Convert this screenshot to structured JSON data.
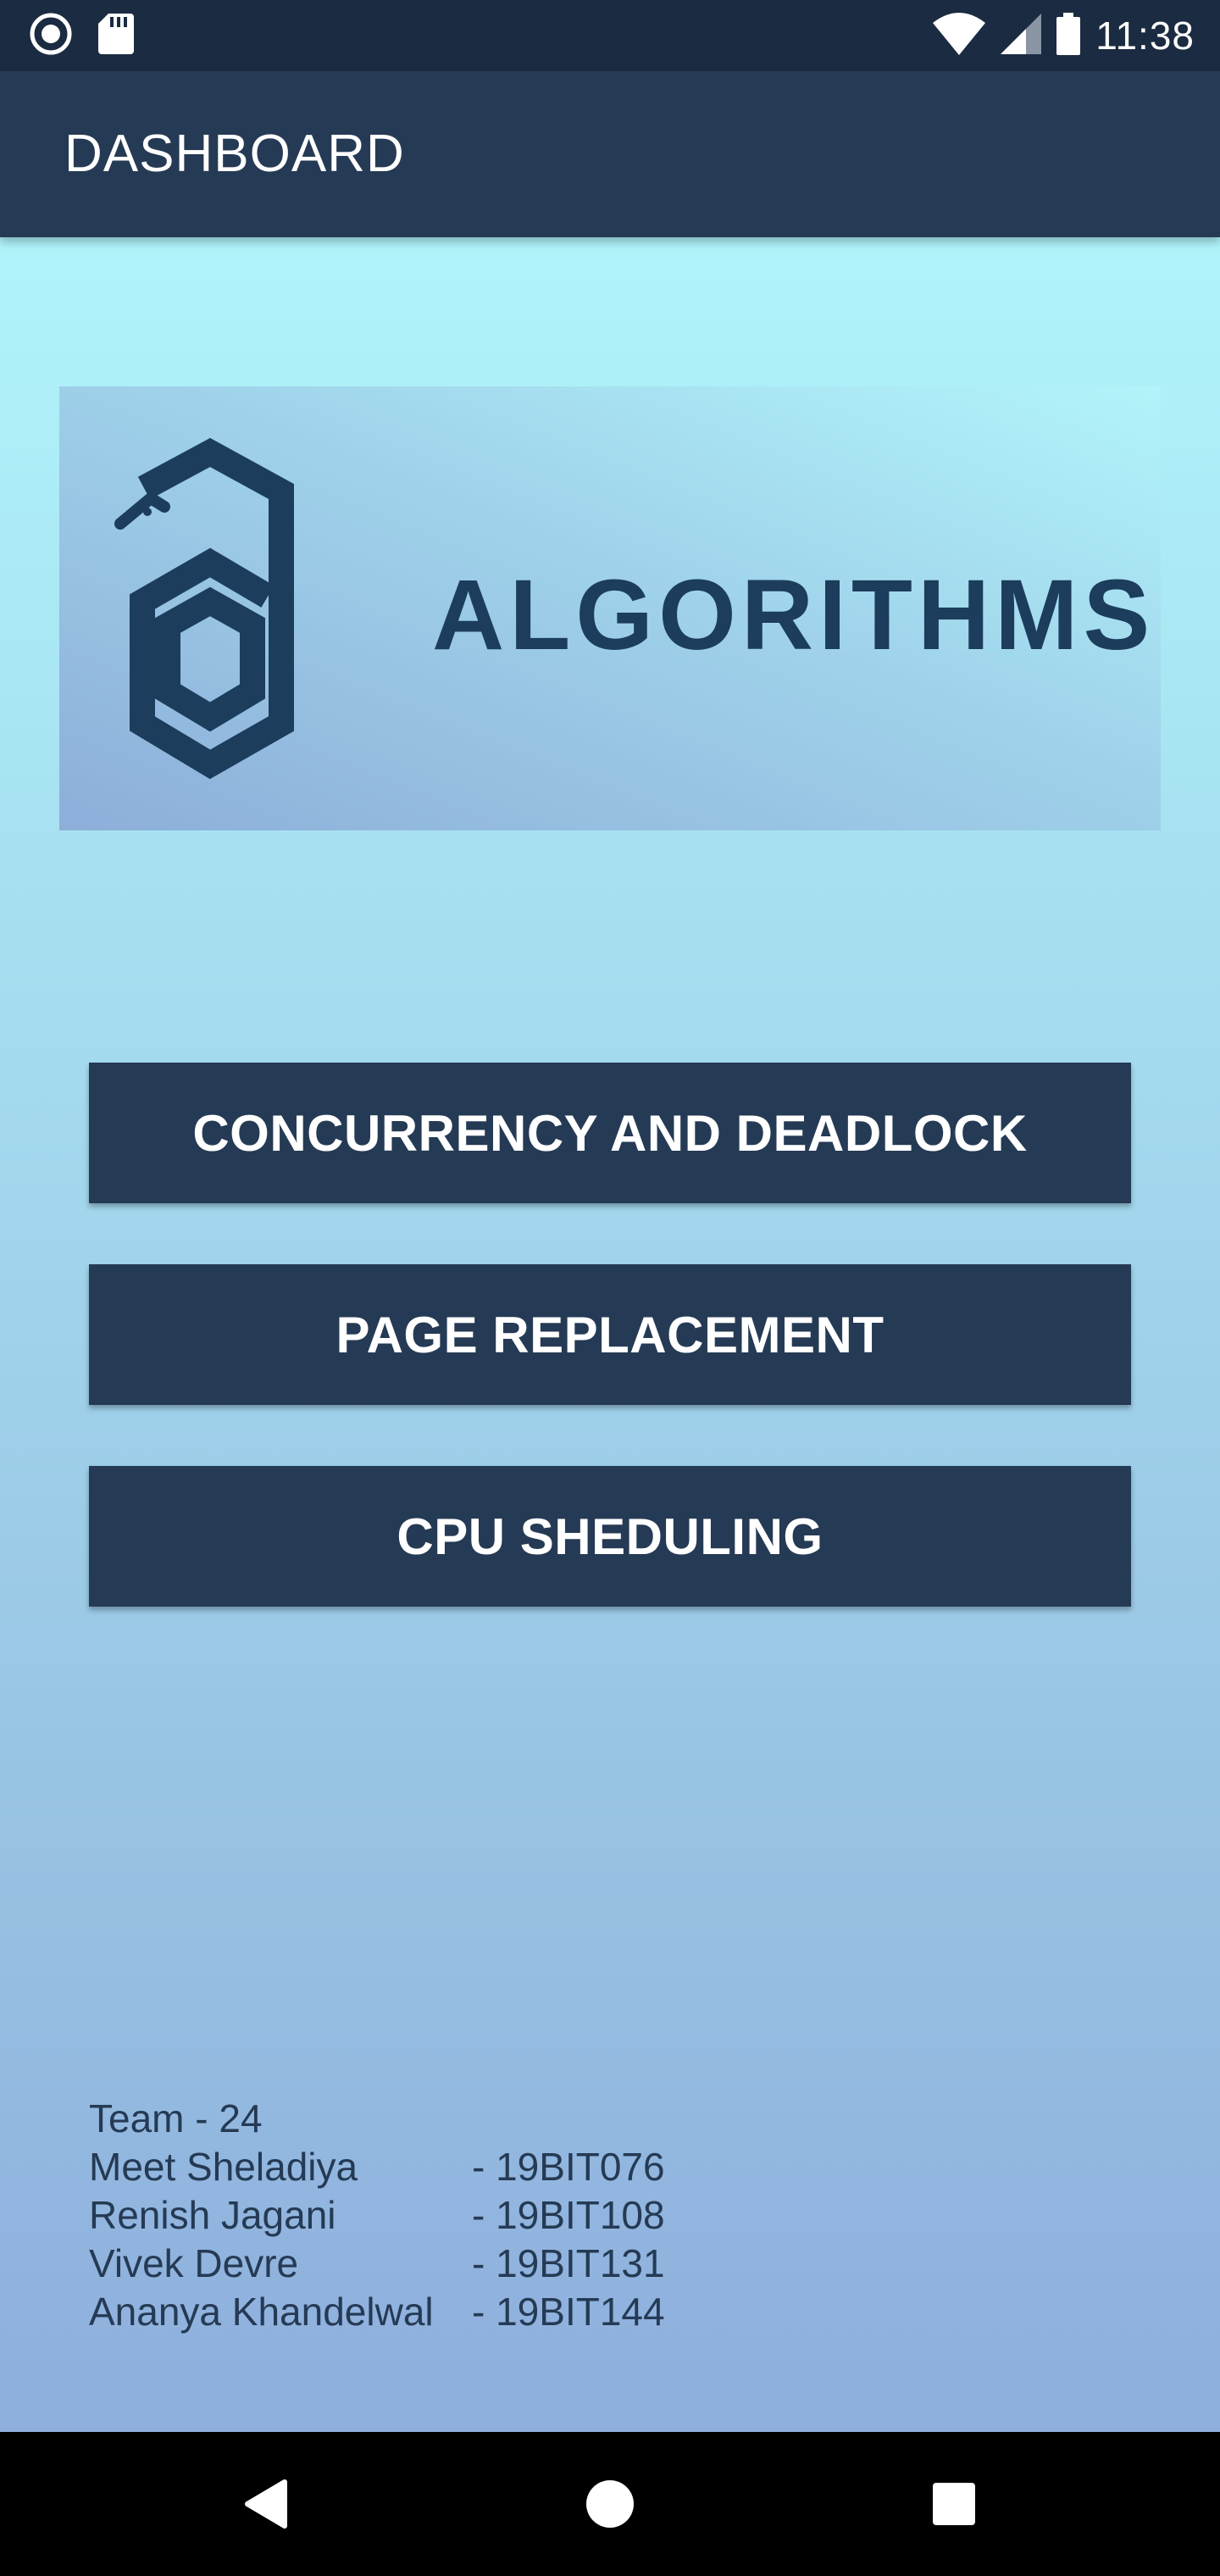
{
  "status_bar": {
    "time": "11:38",
    "icons": [
      "record-icon",
      "sd-card-icon",
      "wifi-icon",
      "signal-icon",
      "battery-icon"
    ]
  },
  "app_bar": {
    "title": "DASHBOARD"
  },
  "logo": {
    "text": "ALGORITHMS",
    "icon": "python-hexagon-logo-icon",
    "color": "#1c3d5c"
  },
  "buttons": [
    {
      "label": "CONCURRENCY AND DEADLOCK"
    },
    {
      "label": "PAGE REPLACEMENT"
    },
    {
      "label": "CPU SHEDULING"
    }
  ],
  "team": {
    "title": "Team - 24",
    "members": [
      {
        "name": "Meet Sheladiya",
        "id": "- 19BIT076"
      },
      {
        "name": "Renish Jagani",
        "id": "- 19BIT108"
      },
      {
        "name": "Vivek Devre",
        "id": "- 19BIT131"
      },
      {
        "name": "Ananya Khandelwal",
        "id": "- 19BIT144"
      }
    ]
  },
  "nav_bar": {
    "icons": [
      "back-icon",
      "home-icon",
      "recents-icon"
    ]
  },
  "colors": {
    "status_bar": "#1b2b41",
    "app_bar": "#253a54",
    "button": "#253a54",
    "background_top": "#b0f4fa",
    "background_bottom": "#8eaedc"
  }
}
